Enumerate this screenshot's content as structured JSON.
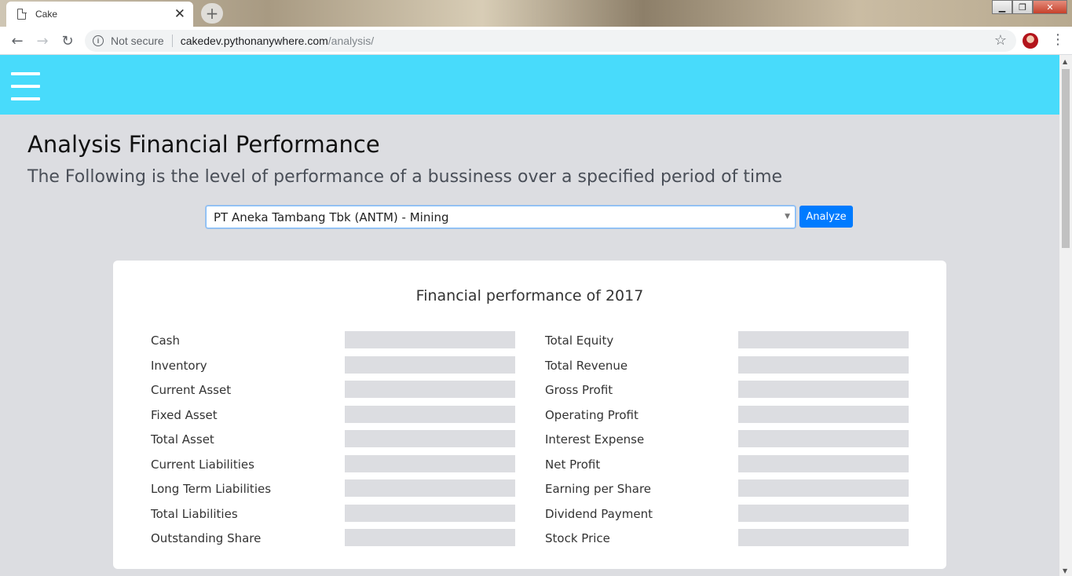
{
  "browser": {
    "tab_title": "Cake",
    "tab_close": "✕",
    "new_tab": "+",
    "not_secure": "Not secure",
    "url_host": "cakedev.pythonanywhere.com",
    "url_path": "/analysis/",
    "icons": [
      "page-icon",
      "back-icon",
      "forward-icon",
      "reload-icon",
      "info-icon",
      "star-icon",
      "avatar",
      "menu-icon"
    ]
  },
  "page": {
    "title": "Analysis Financial Performance",
    "subtitle": "The Following is the level of performance of a bussiness over a specified period of time",
    "company_select": "PT Aneka Tambang Tbk (ANTM) - Mining",
    "analyze_label": "Analyze",
    "navbar_color": "#48dbfb",
    "button_color": "#007bff"
  },
  "card": {
    "title": "Financial performance of 2017",
    "left_rows": [
      {
        "label": "Cash"
      },
      {
        "label": "Inventory"
      },
      {
        "label": "Current Asset"
      },
      {
        "label": "Fixed Asset"
      },
      {
        "label": "Total Asset"
      },
      {
        "label": "Current Liabilities"
      },
      {
        "label": "Long Term Liabilities"
      },
      {
        "label": "Total Liabilities"
      },
      {
        "label": "Outstanding Share"
      }
    ],
    "right_rows": [
      {
        "label": "Total Equity"
      },
      {
        "label": "Total Revenue"
      },
      {
        "label": "Gross Profit"
      },
      {
        "label": "Operating Profit"
      },
      {
        "label": "Interest Expense"
      },
      {
        "label": "Net Profit"
      },
      {
        "label": "Earning per Share"
      },
      {
        "label": "Dividend Payment"
      },
      {
        "label": "Stock Price"
      }
    ]
  }
}
